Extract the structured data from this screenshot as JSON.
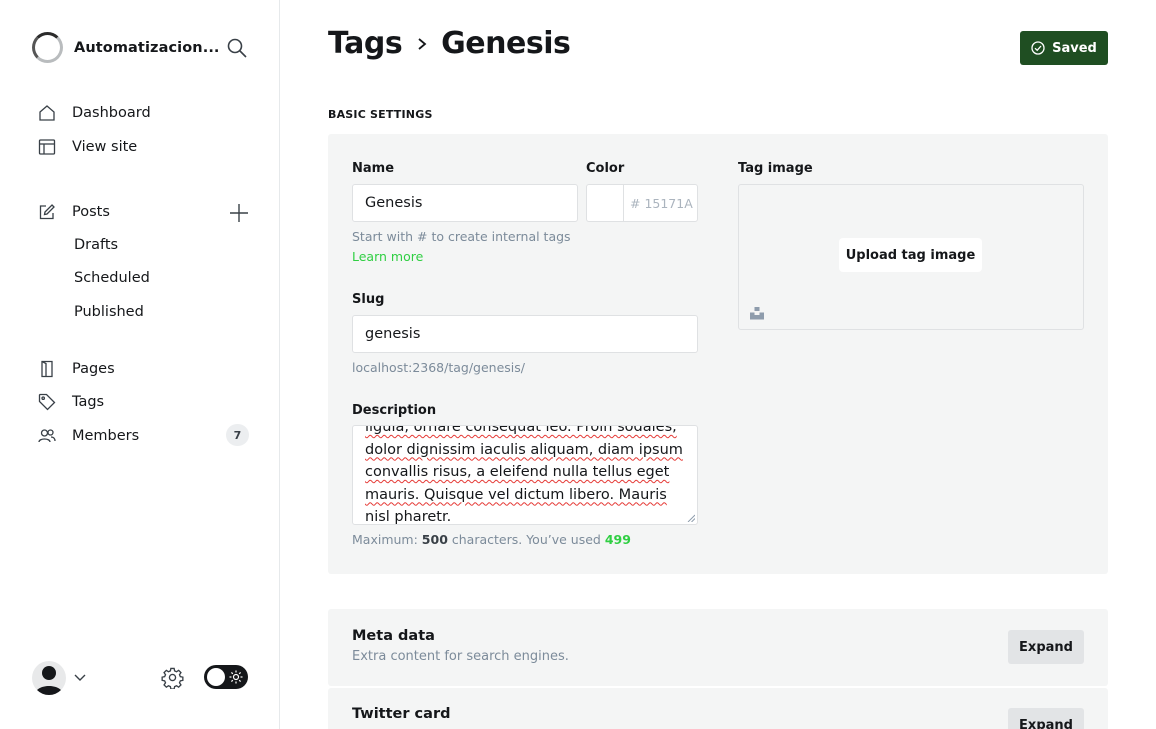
{
  "sidebar": {
    "site_name": "Automatizacion...",
    "nav": {
      "dashboard": "Dashboard",
      "view_site": "View site",
      "posts": "Posts",
      "drafts": "Drafts",
      "scheduled": "Scheduled",
      "published": "Published",
      "pages": "Pages",
      "tags": "Tags",
      "members": "Members",
      "members_count": "7"
    }
  },
  "header": {
    "crumb_parent": "Tags",
    "crumb_current": "Genesis",
    "saved_label": "Saved"
  },
  "basic_settings": {
    "section_label": "BASIC SETTINGS",
    "name_label": "Name",
    "name_value": "Genesis",
    "color_label": "Color",
    "color_placeholder": "# 15171A",
    "name_hint": "Start with # to create internal tags",
    "learn_more": "Learn more",
    "slug_label": "Slug",
    "slug_value": "genesis",
    "slug_url": "localhost:2368/tag/genesis/",
    "description_label": "Description",
    "description_value": "ligula, ornare consequat leo. Proin sodales, dolor dignissim iaculis aliquam, diam ipsum convallis risus, a eleifend nulla tellus eget mauris. Quisque vel dictum libero. Mauris nisl pharetr.",
    "counter_prefix": "Maximum:",
    "counter_max": "500",
    "counter_middle": "characters. You’ve used",
    "counter_used": "499",
    "tag_image_label": "Tag image",
    "upload_label": "Upload tag image"
  },
  "cards": [
    {
      "title": "Meta data",
      "subtitle": "Extra content for search engines.",
      "button": "Expand"
    },
    {
      "title": "Twitter card",
      "button": "Expand"
    }
  ],
  "colors": {
    "accent_green": "#30cf43",
    "saved_bg": "#1f4e22",
    "panel_bg": "#f4f5f5"
  }
}
